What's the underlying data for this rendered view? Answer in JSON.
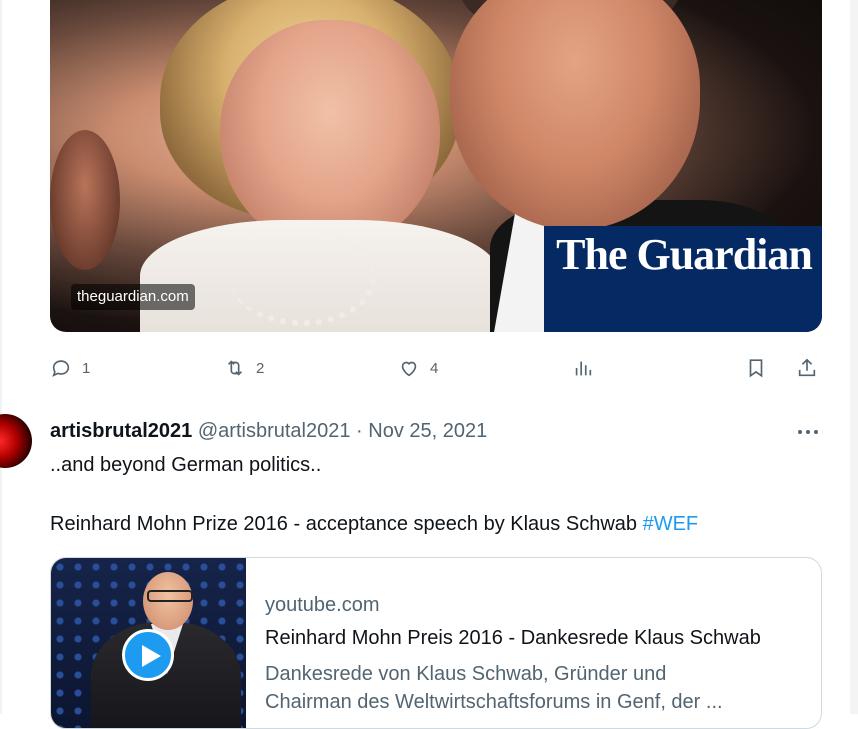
{
  "tweet1": {
    "media": {
      "source_badge": "theguardian.com",
      "logo_text": "The Guardian"
    },
    "actions": {
      "reply": {
        "icon": "reply-icon",
        "count": "1"
      },
      "retweet": {
        "icon": "retweet-icon",
        "count": "2"
      },
      "like": {
        "icon": "heart-icon",
        "count": "4"
      },
      "views": {
        "icon": "analytics-icon"
      },
      "bookmark": {
        "icon": "bookmark-icon"
      },
      "share": {
        "icon": "share-icon"
      }
    }
  },
  "tweet2": {
    "display_name": "artisbrutal2021",
    "handle": "@artisbrutal2021",
    "separator": "·",
    "date": "Nov 25, 2021",
    "line1": "..and beyond German politics..",
    "line2": "Reinhard Mohn Prize 2016 - acceptance speech by Klaus Schwab",
    "hashtag": "#WEF",
    "card": {
      "domain": "youtube.com",
      "title": "Reinhard Mohn Preis 2016 - Dankesrede Klaus Schwab",
      "description_line1": "Dankesrede von Klaus Schwab, Gründer und",
      "description_line2": "Chairman des Weltwirtschaftsforums in Genf, der ..."
    }
  },
  "colors": {
    "accent": "#1d9bf0",
    "secondary_text": "#536471",
    "guardian_blue": "#052962"
  }
}
